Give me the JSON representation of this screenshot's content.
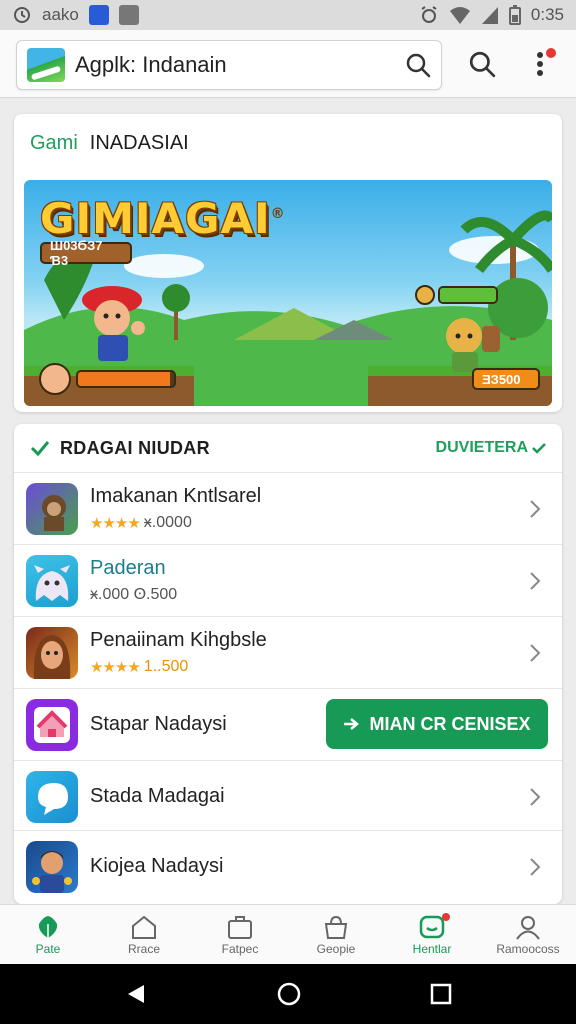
{
  "status_bar": {
    "left_text": "aako",
    "time": "0:35"
  },
  "app_bar": {
    "search_text": "Agplk: Indanain",
    "icons": [
      "search-icon",
      "search-icon",
      "more-vert-icon"
    ]
  },
  "featured": {
    "label_green": "Gami",
    "label": "INADASIAI",
    "banner_title": "GIMIAGAI",
    "banner_badge": "®",
    "banner_score_left": "Ш03ϬЗ7 Ɓ3",
    "banner_score_right": "ƎЗ500"
  },
  "list": {
    "title": "RDAGAI NIUDAR",
    "more_label": "DUVIETERA",
    "cta_label": "MIAN CR CENISEX",
    "items": [
      {
        "name": "Imakanan Kntlsarel",
        "rating_stars": "★★★★",
        "meta": "ӿ.0000",
        "icon": "game-monkey-icon"
      },
      {
        "name": "Paderan",
        "meta": "ӿ.000 ʘ.500",
        "icon": "game-ghost-icon"
      },
      {
        "name": "Penaiinam Kihgbsle",
        "rating_stars": "★★★★",
        "meta": "1..500",
        "icon": "game-hero-icon"
      },
      {
        "name": "Stapar Nadaysi",
        "icon": "home-app-icon"
      },
      {
        "name": "Stada Madagai",
        "icon": "chat-app-icon"
      },
      {
        "name": "Kiojea Nadaysi",
        "icon": "game-character-icon"
      }
    ]
  },
  "bottom_nav": [
    {
      "label": "Pate",
      "icon": "leaf-icon"
    },
    {
      "label": "Rrace",
      "icon": "house-outline-icon"
    },
    {
      "label": "Fatpec",
      "icon": "briefcase-icon"
    },
    {
      "label": "Geopie",
      "icon": "bag-icon"
    },
    {
      "label": "Hentlar",
      "icon": "message-icon"
    },
    {
      "label": "Ramoocoss",
      "icon": "person-icon"
    }
  ],
  "colors": {
    "accent": "#169a55",
    "badge": "#e53935",
    "star": "#f5a623"
  }
}
